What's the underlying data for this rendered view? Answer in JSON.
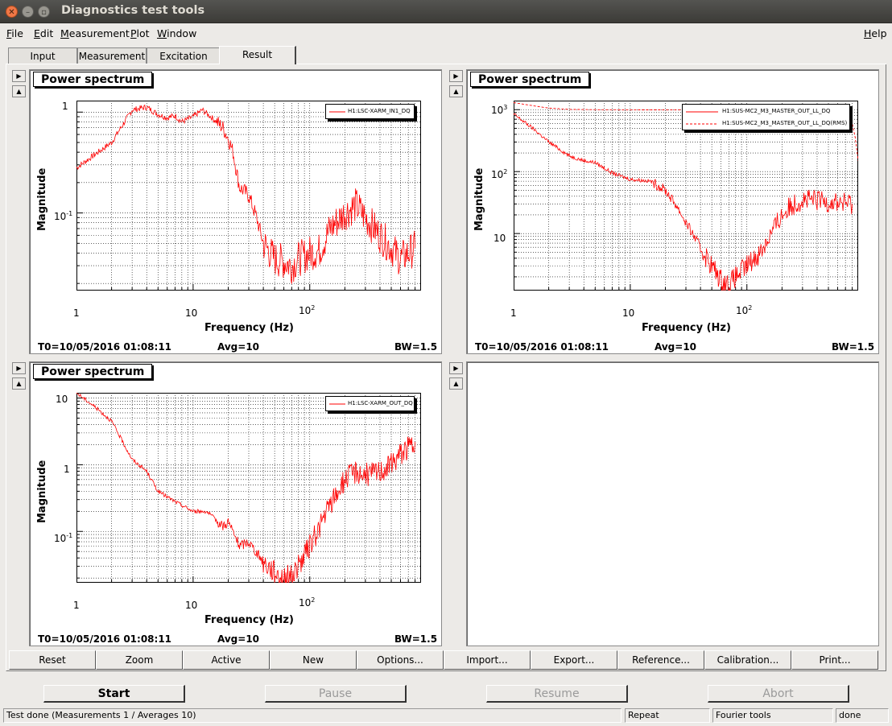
{
  "window": {
    "title": "Diagnostics test tools"
  },
  "menu": [
    "File",
    "Edit",
    "Measurement",
    "Plot",
    "Window"
  ],
  "menu_help": "Help",
  "tabs": [
    "Input",
    "Measurement",
    "Excitation",
    "Result"
  ],
  "active_tab": "Result",
  "plots": [
    {
      "title": "Power spectrum",
      "ylabel": "Magnitude",
      "xlabel": "Frequency (Hz)",
      "legend": [
        "H1:LSC-XARM_IN1_DQ"
      ],
      "yticks": [
        "1",
        "10",
        "-1"
      ],
      "xticks": [
        "1",
        "10",
        "10",
        "2"
      ],
      "t0": "T0=10/05/2016 01:08:11",
      "avg": "Avg=10",
      "bw": "BW=1.5"
    },
    {
      "title": "Power spectrum",
      "ylabel": "Magnitude",
      "xlabel": "Frequency (Hz)",
      "legend": [
        "H1:SUS-MC2_M3_MASTER_OUT_LL_DQ",
        "H1:SUS-MC2_M3_MASTER_OUT_LL_DQ(RMS)"
      ],
      "yticks": [
        "10",
        "3",
        "10",
        "2",
        "10"
      ],
      "xticks": [
        "1",
        "10",
        "10",
        "2"
      ],
      "t0": "T0=10/05/2016 01:08:11",
      "avg": "Avg=10",
      "bw": "BW=1.5"
    },
    {
      "title": "Power spectrum",
      "ylabel": "Magnitude",
      "xlabel": "Frequency (Hz)",
      "legend": [
        "H1:LSC-XARM_OUT_DQ"
      ],
      "yticks": [
        "10",
        "1",
        "10",
        "-1"
      ],
      "xticks": [
        "1",
        "10",
        "10",
        "2"
      ],
      "t0": "T0=10/05/2016 01:08:11",
      "avg": "Avg=10",
      "bw": "BW=1.5"
    }
  ],
  "toolbar": [
    "Reset",
    "Zoom",
    "Active",
    "New",
    "Options...",
    "Import...",
    "Export...",
    "Reference...",
    "Calibration...",
    "Print..."
  ],
  "controls": {
    "start": "Start",
    "pause": "Pause",
    "resume": "Resume",
    "abort": "Abort"
  },
  "status": {
    "message": "Test done (Measurements 1 / Averages 10)",
    "repeat": "Repeat",
    "tool": "Fourier tools",
    "state": "done"
  },
  "colors": {
    "trace": "#ff0000",
    "titlebar": "#3c3b37",
    "close": "#f07746"
  },
  "icons": {
    "close": "close-icon",
    "minimize": "minimize-icon",
    "maximize": "maximize-icon",
    "scroll_right": "triangle-right-icon",
    "scroll_up": "triangle-up-icon"
  },
  "chart_data": [
    {
      "type": "line",
      "title": "Power spectrum",
      "xlabel": "Frequency (Hz)",
      "ylabel": "Magnitude",
      "xscale": "log",
      "yscale": "log",
      "xlim": [
        1,
        900
      ],
      "ylim": [
        0.017,
        1.3
      ],
      "grid": true,
      "legend_position": "top-right",
      "series": [
        {
          "name": "H1:LSC-XARM_IN1_DQ",
          "style": "solid",
          "x": [
            1,
            2,
            3,
            4,
            5,
            6,
            7,
            8,
            9,
            10,
            12,
            15,
            18,
            20,
            22,
            25,
            30,
            35,
            40,
            50,
            60,
            70,
            80,
            100,
            120,
            150,
            200,
            250,
            300,
            400,
            500,
            600,
            800
          ],
          "y": [
            0.28,
            0.5,
            1.05,
            1.12,
            0.95,
            0.88,
            0.92,
            0.8,
            0.85,
            0.9,
            1.05,
            0.85,
            0.7,
            0.55,
            0.4,
            0.18,
            0.15,
            0.09,
            0.05,
            0.035,
            0.033,
            0.03,
            0.035,
            0.04,
            0.042,
            0.07,
            0.1,
            0.12,
            0.09,
            0.06,
            0.045,
            0.035,
            0.045
          ]
        }
      ]
    },
    {
      "type": "line",
      "title": "Power spectrum",
      "xlabel": "Frequency (Hz)",
      "ylabel": "Magnitude",
      "xscale": "log",
      "yscale": "log",
      "xlim": [
        1,
        900
      ],
      "ylim": [
        1.2,
        1400
      ],
      "grid": true,
      "legend_position": "top-right",
      "series": [
        {
          "name": "H1:SUS-MC2_M3_MASTER_OUT_LL_DQ",
          "style": "solid",
          "x": [
            1,
            1.5,
            2,
            3,
            4,
            5,
            7,
            10,
            15,
            20,
            25,
            30,
            40,
            50,
            60,
            70,
            80,
            100,
            130,
            150,
            200,
            250,
            300,
            400,
            500,
            600,
            800
          ],
          "y": [
            850,
            480,
            300,
            180,
            150,
            140,
            95,
            75,
            70,
            50,
            28,
            15,
            6,
            3,
            1.8,
            1.5,
            2,
            3,
            5,
            8,
            20,
            30,
            35,
            34,
            33,
            32,
            30
          ]
        },
        {
          "name": "H1:SUS-MC2_M3_MASTER_OUT_LL_DQ(RMS)",
          "style": "dashed",
          "x": [
            1,
            1.5,
            2,
            3,
            5,
            10,
            20,
            50,
            100,
            200,
            300,
            500,
            700,
            800,
            850,
            900
          ],
          "y": [
            1300,
            1150,
            1060,
            1010,
            1000,
            995,
            990,
            985,
            985,
            985,
            985,
            980,
            900,
            600,
            350,
            150
          ]
        }
      ]
    },
    {
      "type": "line",
      "title": "Power spectrum",
      "xlabel": "Frequency (Hz)",
      "ylabel": "Magnitude",
      "xscale": "log",
      "yscale": "log",
      "xlim": [
        1,
        900
      ],
      "ylim": [
        0.017,
        12
      ],
      "grid": true,
      "legend_position": "top-right",
      "series": [
        {
          "name": "H1:LSC-XARM_OUT_DQ",
          "style": "solid",
          "x": [
            1,
            1.5,
            2,
            3,
            4,
            5,
            7,
            10,
            13,
            15,
            18,
            20,
            25,
            30,
            40,
            50,
            60,
            70,
            80,
            100,
            130,
            150,
            200,
            250,
            300,
            400,
            500,
            600,
            800
          ],
          "y": [
            12,
            7,
            4.5,
            1.2,
            0.8,
            0.4,
            0.28,
            0.2,
            0.2,
            0.16,
            0.12,
            0.14,
            0.06,
            0.07,
            0.035,
            0.025,
            0.02,
            0.022,
            0.03,
            0.06,
            0.15,
            0.25,
            0.6,
            0.8,
            0.7,
            0.8,
            1.0,
            1.5,
            2.2
          ]
        }
      ]
    }
  ]
}
